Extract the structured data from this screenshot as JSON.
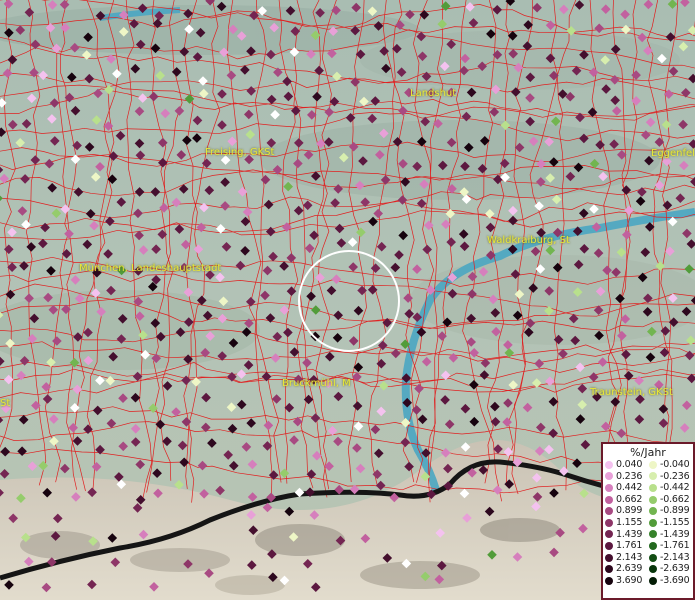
{
  "places": [
    {
      "id": "landshut",
      "label": "Landshut"
    },
    {
      "id": "freising",
      "label": "Freising, GKSt"
    },
    {
      "id": "eggenfelden",
      "label": "Eggenfel"
    },
    {
      "id": "waldkraiburg",
      "label": "Waldkraiburg, St"
    },
    {
      "id": "muenchen",
      "label": "München, Landeshauptstadt"
    },
    {
      "id": "bruckmuehl",
      "label": "Bruckmühl, M"
    },
    {
      "id": "traunstein",
      "label": "Traunstein, GKSt"
    },
    {
      "id": "left-edge",
      "label": "St"
    }
  ],
  "legend": {
    "title": "%/Jahr",
    "positive": [
      {
        "value": "0.040",
        "color": "#f4c2ef"
      },
      {
        "value": "0.236",
        "color": "#e8a0d8"
      },
      {
        "value": "0.442",
        "color": "#d67fbd"
      },
      {
        "value": "0.662",
        "color": "#c2619f"
      },
      {
        "value": "0.899",
        "color": "#a84a82"
      },
      {
        "value": "1.155",
        "color": "#8e3668"
      },
      {
        "value": "1.439",
        "color": "#742552"
      },
      {
        "value": "1.761",
        "color": "#5c1840"
      },
      {
        "value": "2.143",
        "color": "#440f2e"
      },
      {
        "value": "2.639",
        "color": "#2d081e"
      },
      {
        "value": "3.690",
        "color": "#16030e"
      }
    ],
    "negative": [
      {
        "value": "-0.040",
        "color": "#eef6c6"
      },
      {
        "value": "-0.236",
        "color": "#d7eeae"
      },
      {
        "value": "-0.442",
        "color": "#b8e08c"
      },
      {
        "value": "-0.662",
        "color": "#95cc6c"
      },
      {
        "value": "-0.899",
        "color": "#72b550"
      },
      {
        "value": "-1.155",
        "color": "#529c3a"
      },
      {
        "value": "-1.439",
        "color": "#36822a"
      },
      {
        "value": "-1.761",
        "color": "#22681e"
      },
      {
        "value": "-2.143",
        "color": "#134e14"
      },
      {
        "value": "-2.639",
        "color": "#08360b"
      },
      {
        "value": "-3.690",
        "color": "#031c05"
      }
    ]
  },
  "colors": {
    "boundary": "#e02020",
    "river": "#4aa6c2",
    "border": "#151515",
    "selection_ring": "#ffffff"
  }
}
